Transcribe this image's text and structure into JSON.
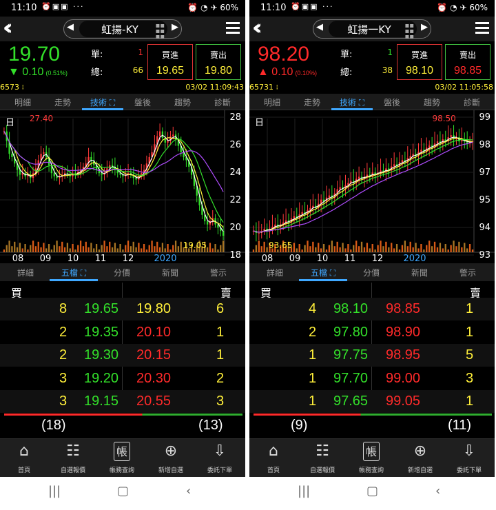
{
  "panels": [
    {
      "status": {
        "time": "11:10",
        "battery": "60%"
      },
      "stock_name": "虹揚-KY",
      "price": "19.70",
      "price_color": "#33e02a",
      "change_arrow": "▼",
      "change": "0.10",
      "change_pct": "(0.51%)",
      "change_color": "#33e02a",
      "single_label": "單:",
      "single_value": "1",
      "single_color": "#ff3030",
      "total_label": "總:",
      "total_value": "66",
      "bid_label": "買進",
      "bid_value": "19.65",
      "bid_color": "#ffef3a",
      "ask_label": "賣出",
      "ask_value": "19.80",
      "ask_color": "#ffef3a",
      "volume": "6573",
      "datetime": "03/02 11:09:43",
      "tabs": [
        "明細",
        "走勢",
        "技術",
        "盤後",
        "趨勢",
        "診斷"
      ],
      "active_tab": 2,
      "chart": {
        "period_label": "日",
        "y_ticks": [
          "28",
          "26",
          "24",
          "22",
          "20",
          "18"
        ],
        "x_ticks": [
          "08",
          "09",
          "10",
          "11",
          "12",
          "2020"
        ],
        "high_label": "27.40",
        "low_label": "19.05",
        "low_color": "#ffef3a",
        "closes": [
          26.2,
          25.6,
          24.8,
          24.6,
          24.2,
          23.8,
          23.5,
          23.6,
          23.4,
          23.5,
          23.3,
          23.6,
          23.9,
          24.4,
          24.8,
          24.9,
          24.6,
          24.1,
          23.6,
          23.4,
          23.3,
          23.4,
          23.5,
          23.6,
          23.5,
          23.4,
          23.6,
          23.5,
          23.7,
          23.8,
          24.0,
          24.2,
          24.6,
          24.4,
          24.1,
          23.8,
          23.6,
          23.5,
          23.6,
          23.9,
          24.1,
          24.0,
          23.8,
          23.6,
          23.5,
          23.4,
          23.5,
          23.6,
          23.5,
          23.3,
          23.2,
          23.4,
          23.6,
          23.8,
          24.2,
          24.6,
          24.9,
          25.4,
          25.9,
          26.2,
          25.8,
          25.5,
          25.6,
          25.9,
          26.0,
          25.7,
          25.3,
          24.9,
          24.6,
          24.4,
          24.0,
          23.5,
          22.8,
          22.2,
          21.6,
          21.0,
          20.6,
          20.4,
          20.6,
          20.8,
          20.4,
          20.2,
          20.0,
          19.7
        ]
      },
      "subtabs": [
        "詳細",
        "五檔",
        "分價",
        "新聞",
        "警示"
      ],
      "active_subtab": 1,
      "book": {
        "buy_label": "買",
        "sell_label": "賣",
        "rows": [
          {
            "bid_qty": "8",
            "bid": "19.65",
            "ask": "19.80",
            "ask_qty": "6",
            "ask_color": "#ffef3a"
          },
          {
            "bid_qty": "2",
            "bid": "19.35",
            "ask": "20.10",
            "ask_qty": "1",
            "ask_color": "#ff2a2a"
          },
          {
            "bid_qty": "2",
            "bid": "19.30",
            "ask": "20.15",
            "ask_qty": "1",
            "ask_color": "#ff2a2a"
          },
          {
            "bid_qty": "3",
            "bid": "19.20",
            "ask": "20.30",
            "ask_qty": "2",
            "ask_color": "#ff2a2a"
          },
          {
            "bid_qty": "3",
            "bid": "19.15",
            "ask": "20.55",
            "ask_qty": "3",
            "ask_color": "#ff2a2a"
          }
        ],
        "bid_total": "(18)",
        "ask_total": "(13)",
        "bid_ratio": 0.58
      },
      "nav": [
        "首頁",
        "自選報價",
        "帳務查詢",
        "新增自選",
        "委託下單"
      ]
    },
    {
      "status": {
        "time": "11:10",
        "battery": "60%"
      },
      "stock_name": "虹揚一KY",
      "price": "98.20",
      "price_color": "#ff2a2a",
      "change_arrow": "▲",
      "change": "0.10",
      "change_pct": "(0.10%)",
      "change_color": "#ff2a2a",
      "single_label": "單:",
      "single_value": "1",
      "single_color": "#33e02a",
      "total_label": "總:",
      "total_value": "38",
      "bid_label": "買進",
      "bid_value": "98.10",
      "bid_color": "#ffef3a",
      "ask_label": "賣出",
      "ask_value": "98.85",
      "ask_color": "#ff2a2a",
      "volume": "65731",
      "datetime": "03/02 11:05:58",
      "tabs": [
        "明細",
        "走勢",
        "技術",
        "盤後",
        "趨勢",
        "診斷"
      ],
      "active_tab": 2,
      "chart": {
        "period_label": "日",
        "y_ticks": [
          "99",
          "98",
          "97",
          "95",
          "94",
          "93"
        ],
        "x_ticks": [
          "08",
          "09",
          "10",
          "11",
          "12",
          "2020"
        ],
        "high_label": "98.50",
        "low_label": "93.65",
        "low_color": "#ffef3a",
        "closes": [
          93.9,
          93.8,
          93.8,
          93.9,
          94.0,
          93.9,
          94.0,
          94.1,
          94.2,
          94.1,
          94.2,
          94.3,
          94.4,
          94.3,
          94.5,
          94.6,
          94.5,
          94.7,
          94.8,
          94.7,
          94.9,
          95.0,
          95.1,
          95.0,
          95.2,
          95.4,
          95.3,
          95.5,
          95.6,
          95.5,
          95.7,
          95.9,
          96.0,
          95.9,
          96.1,
          96.2,
          96.3,
          96.2,
          96.4,
          96.5,
          96.4,
          96.5,
          96.6,
          96.5,
          96.7,
          96.6,
          96.7,
          96.8,
          96.7,
          96.9,
          96.8,
          97.0,
          97.1,
          97.0,
          97.2,
          97.3,
          97.2,
          97.4,
          97.5,
          97.6,
          97.5,
          97.7,
          97.8,
          97.7,
          97.9,
          98.0,
          97.9,
          98.1,
          98.2,
          98.1,
          98.3,
          98.2,
          98.4,
          98.5,
          98.3,
          98.4,
          98.2,
          98.3,
          98.2,
          98.1,
          98.2,
          98.2
        ]
      },
      "subtabs": [
        "詳細",
        "五檔",
        "分價",
        "新聞",
        "警示"
      ],
      "active_subtab": 1,
      "book": {
        "buy_label": "買",
        "sell_label": "賣",
        "rows": [
          {
            "bid_qty": "4",
            "bid": "98.10",
            "ask": "98.85",
            "ask_qty": "1",
            "ask_color": "#ff2a2a"
          },
          {
            "bid_qty": "2",
            "bid": "97.80",
            "ask": "98.90",
            "ask_qty": "1",
            "ask_color": "#ff2a2a"
          },
          {
            "bid_qty": "1",
            "bid": "97.75",
            "ask": "98.95",
            "ask_qty": "5",
            "ask_color": "#ff2a2a"
          },
          {
            "bid_qty": "1",
            "bid": "97.70",
            "ask": "99.00",
            "ask_qty": "3",
            "ask_color": "#ff2a2a"
          },
          {
            "bid_qty": "1",
            "bid": "97.65",
            "ask": "99.05",
            "ask_qty": "1",
            "ask_color": "#ff2a2a"
          }
        ],
        "bid_total": "(9)",
        "ask_total": "(11)",
        "bid_ratio": 0.45
      },
      "nav": [
        "首頁",
        "自選報價",
        "帳務查詢",
        "新增自選",
        "委託下單"
      ]
    }
  ]
}
